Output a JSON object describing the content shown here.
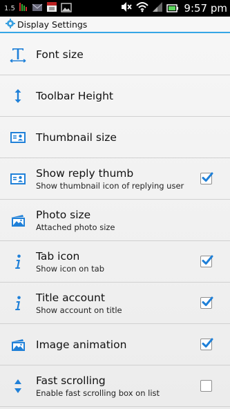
{
  "status_bar": {
    "signal_text": "1.5",
    "time": "9:57 pm",
    "icons": [
      "network-speed-icon",
      "battery-app-icon",
      "mail-icon",
      "calendar-icon",
      "gallery-icon",
      "mute-icon",
      "wifi-icon",
      "signal-icon",
      "battery-icon"
    ]
  },
  "title_bar": {
    "icon": "settings-app-icon",
    "title": "Display Settings"
  },
  "accent_color": "#1f80d8",
  "settings": [
    {
      "id": "font-size",
      "icon": "font-icon",
      "label": "Font size",
      "summary": ""
    },
    {
      "id": "toolbar-height",
      "icon": "vertical-resize-icon",
      "label": "Toolbar Height",
      "summary": ""
    },
    {
      "id": "thumbnail-size",
      "icon": "contact-card-icon",
      "label": "Thumbnail size",
      "summary": ""
    },
    {
      "id": "show-reply-thumb",
      "icon": "contact-card-icon",
      "label": "Show reply thumb",
      "summary": "Show thumbnail icon of replying user",
      "checked": true
    },
    {
      "id": "photo-size",
      "icon": "image-icon",
      "label": "Photo size",
      "summary": "Attached photo size"
    },
    {
      "id": "tab-icon",
      "icon": "info-icon",
      "label": "Tab icon",
      "summary": "Show icon on tab",
      "checked": true
    },
    {
      "id": "title-account",
      "icon": "info-icon",
      "label": "Title account",
      "summary": "Show account on title",
      "checked": true
    },
    {
      "id": "image-animation",
      "icon": "image-icon",
      "label": "Image animation",
      "summary": "",
      "checked": true
    },
    {
      "id": "fast-scrolling",
      "icon": "up-down-arrows-icon",
      "label": "Fast scrolling",
      "summary": "Enable fast scrolling box on list",
      "checked": false
    }
  ]
}
